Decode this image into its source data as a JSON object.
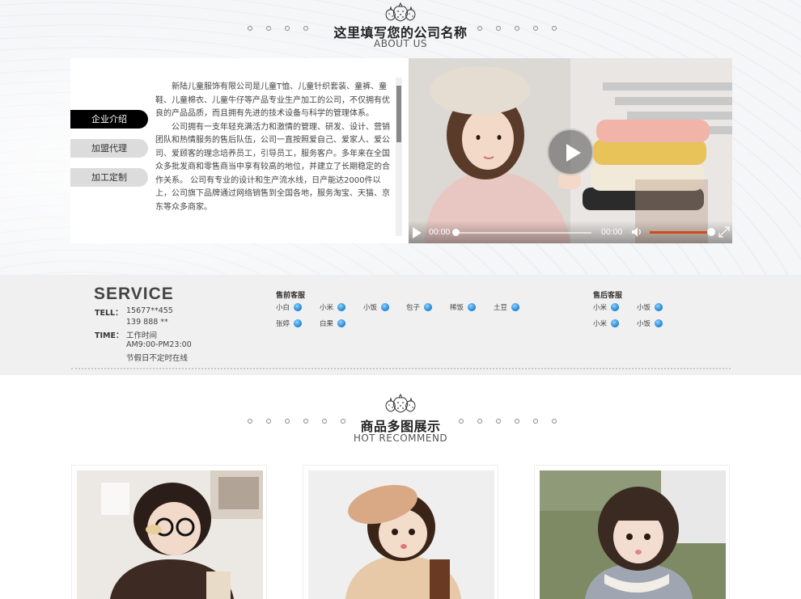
{
  "about_section": {
    "title": "这里填写您的公司名称",
    "subtitle": "ABOUT US",
    "tabs": [
      {
        "label": "企业介绍",
        "active": true
      },
      {
        "label": "加盟代理",
        "active": false
      },
      {
        "label": "加工定制",
        "active": false
      }
    ],
    "paragraphs": [
      "新陆儿童服饰有限公司是儿童T恤、儿童针织套装、童裤、童鞋、儿童棉衣、儿童牛仔等产品专业生产加工的公司，不仅拥有优良的产品品质，而且拥有先进的技术设备与科学的管理体系。",
      "公司拥有一支年轻充满活力和激情的管理、研发、设计、营销团队和热情服务的售后队伍，公司一直按照爱自己、爱家人、爱公司、爱顾客的理念培养员工，引导员工，服务客户。多年来在全国众多批发商和零售商当中享有较高的地位，并建立了长期稳定的合作关系。 公司有专业的设计和生产流水线，日产能达2000件以上，公司旗下品牌通过网络销售到全国各地，服务淘宝、天猫、京东等众多商家。"
    ],
    "video": {
      "current_time": "00:00",
      "duration": "00:00",
      "progress": 0,
      "volume": 0.95
    }
  },
  "service": {
    "title": "SERVICE",
    "tell_label": "TELL：",
    "tell_values": [
      "15677**455",
      "139 888 **"
    ],
    "time_label": "TIME：",
    "time_values": [
      "工作时间",
      "AM9:00-PM23:00",
      "节假日不定时在线"
    ],
    "presale_title": "售前客服",
    "presale_row1": [
      "小白",
      "小米",
      "小饭",
      "包子",
      "稀饭",
      "土豆"
    ],
    "presale_row2": [
      "张婷",
      "白果"
    ],
    "aftersale_title": "售后客服",
    "aftersale_row1": [
      "小米",
      "小饭"
    ],
    "aftersale_row2": [
      "小米",
      "小饭"
    ]
  },
  "products_section": {
    "title": "商品多图展示",
    "subtitle": "HOT RECOMMEND"
  },
  "colors": {
    "active_tab": "#000000",
    "volume_bar": "#d04a1a",
    "qq_icon": "#1a7fd1"
  }
}
